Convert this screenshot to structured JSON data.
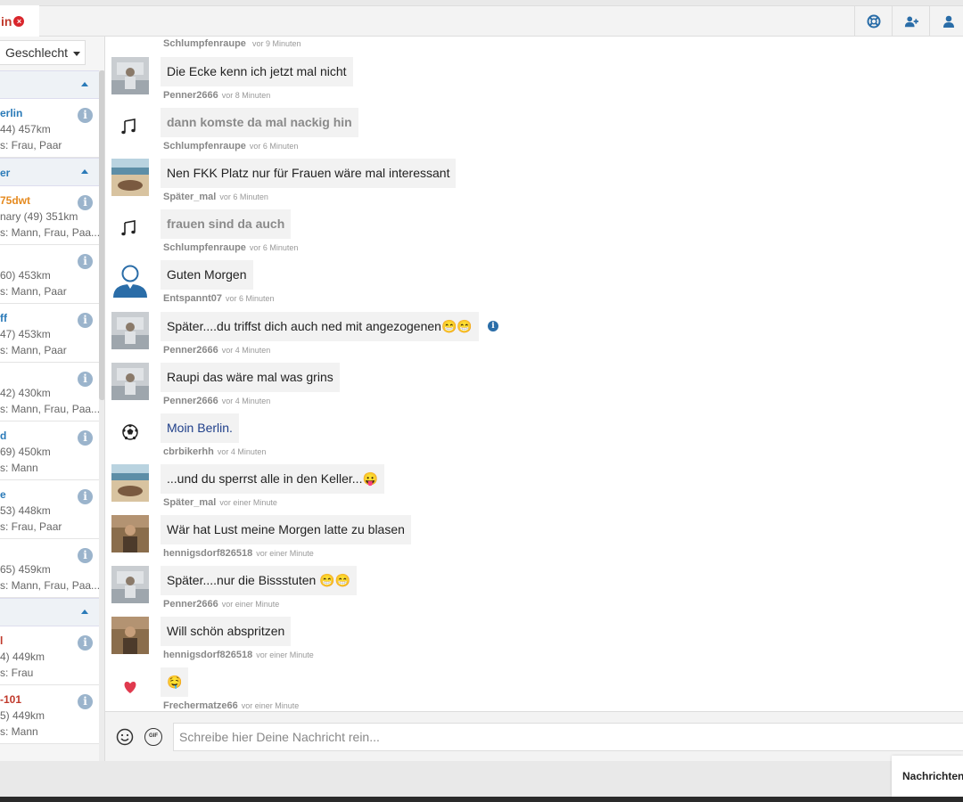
{
  "tab": {
    "label": "in"
  },
  "colors": {
    "accent": "#2a7ab8",
    "orange": "#e58a1f",
    "red": "#c0392b"
  },
  "sidebar": {
    "gender_filter": "Geschlecht",
    "sections": [
      {
        "label": "",
        "users": [
          {
            "name": "erlin",
            "name_color": "#2a7ab8",
            "line2": "44) 457km",
            "line3": "s: Frau, Paar"
          }
        ]
      },
      {
        "label": "er",
        "users": [
          {
            "name": "75dwt",
            "name_color": "#e58a1f",
            "line2": "nary (49) 351km",
            "line3": "s: Mann, Frau, Paa..."
          },
          {
            "name": "",
            "name_color": "#2a7ab8",
            "line2": "60) 453km",
            "line3": "s: Mann, Paar"
          },
          {
            "name": "ff",
            "name_color": "#2a7ab8",
            "line2": "47) 453km",
            "line3": "s: Mann, Paar"
          },
          {
            "name": "",
            "name_color": "#2a7ab8",
            "line2": "42) 430km",
            "line3": "s: Mann, Frau, Paa..."
          },
          {
            "name": "d",
            "name_color": "#2a7ab8",
            "line2": "69) 450km",
            "line3": "s: Mann"
          },
          {
            "name": "e",
            "name_color": "#2a7ab8",
            "line2": "53) 448km",
            "line3": "s: Frau, Paar"
          },
          {
            "name": "",
            "name_color": "#2a7ab8",
            "line2": "65) 459km",
            "line3": "s: Mann, Frau, Paa..."
          }
        ]
      },
      {
        "label": "",
        "users": [
          {
            "name": "l",
            "name_color": "#c0392b",
            "line2": "4) 449km",
            "line3": "s: Frau"
          },
          {
            "name": "-101",
            "name_color": "#c0392b",
            "line2": "5) 449km",
            "line3": "s: Mann"
          }
        ]
      }
    ]
  },
  "chat": {
    "top_author": "Schlumpfenraupe",
    "top_time": "vor 9 Minuten",
    "messages": [
      {
        "avatar": "photo-gray",
        "text": "Die Ecke kenn ich jetzt mal nicht",
        "style": "normal",
        "author": "Penner2666",
        "time": "vor 8 Minuten"
      },
      {
        "avatar": "music",
        "text": "dann komste da mal nackig hin",
        "style": "faded",
        "author": "Schlumpfenraupe",
        "time": "vor 6 Minuten"
      },
      {
        "avatar": "photo-beach",
        "text": "Nen FKK Platz nur für Frauen wäre mal interessant",
        "style": "normal",
        "author": "Später_mal",
        "time": "vor 6 Minuten"
      },
      {
        "avatar": "music",
        "text": "frauen sind da auch",
        "style": "faded",
        "author": "Schlumpfenraupe",
        "time": "vor 6 Minuten"
      },
      {
        "avatar": "person",
        "text": "Guten Morgen",
        "style": "normal",
        "author": "Entspannt07",
        "time": "vor 6 Minuten"
      },
      {
        "avatar": "photo-gray",
        "text": "Später....du triffst dich auch ned mit angezogenen😁😁",
        "style": "normal",
        "author": "Penner2666",
        "time": "vor 4 Minuten",
        "info": true
      },
      {
        "avatar": "photo-gray",
        "text": "Raupi das wäre mal was grins",
        "style": "normal",
        "author": "Penner2666",
        "time": "vor 4 Minuten"
      },
      {
        "avatar": "soccer",
        "text": "Moin Berlin.",
        "style": "blue",
        "author": "cbrbikerhh",
        "time": "vor 4 Minuten"
      },
      {
        "avatar": "photo-beach",
        "text": "...und du sperrst alle in den Keller...😛",
        "style": "normal",
        "author": "Später_mal",
        "time": "vor einer Minute"
      },
      {
        "avatar": "photo-brown",
        "text": "Wär hat Lust meine Morgen latte zu blasen",
        "style": "normal",
        "author": "hennigsdorf826518",
        "time": "vor einer Minute"
      },
      {
        "avatar": "photo-gray",
        "text": "Später....nur die Bissstuten 😁😁",
        "style": "normal",
        "author": "Penner2666",
        "time": "vor einer Minute"
      },
      {
        "avatar": "photo-brown",
        "text": "Will schön abspritzen",
        "style": "normal",
        "author": "hennigsdorf826518",
        "time": "vor einer Minute"
      },
      {
        "avatar": "heart",
        "text": "🤤",
        "style": "normal",
        "author": "Frechermatze66",
        "time": "vor einer Minute"
      }
    ]
  },
  "composer": {
    "placeholder": "Schreibe hier Deine Nachricht rein...",
    "gif_label": "GIF"
  },
  "bottom": {
    "messages_label": "Nachrichten"
  }
}
